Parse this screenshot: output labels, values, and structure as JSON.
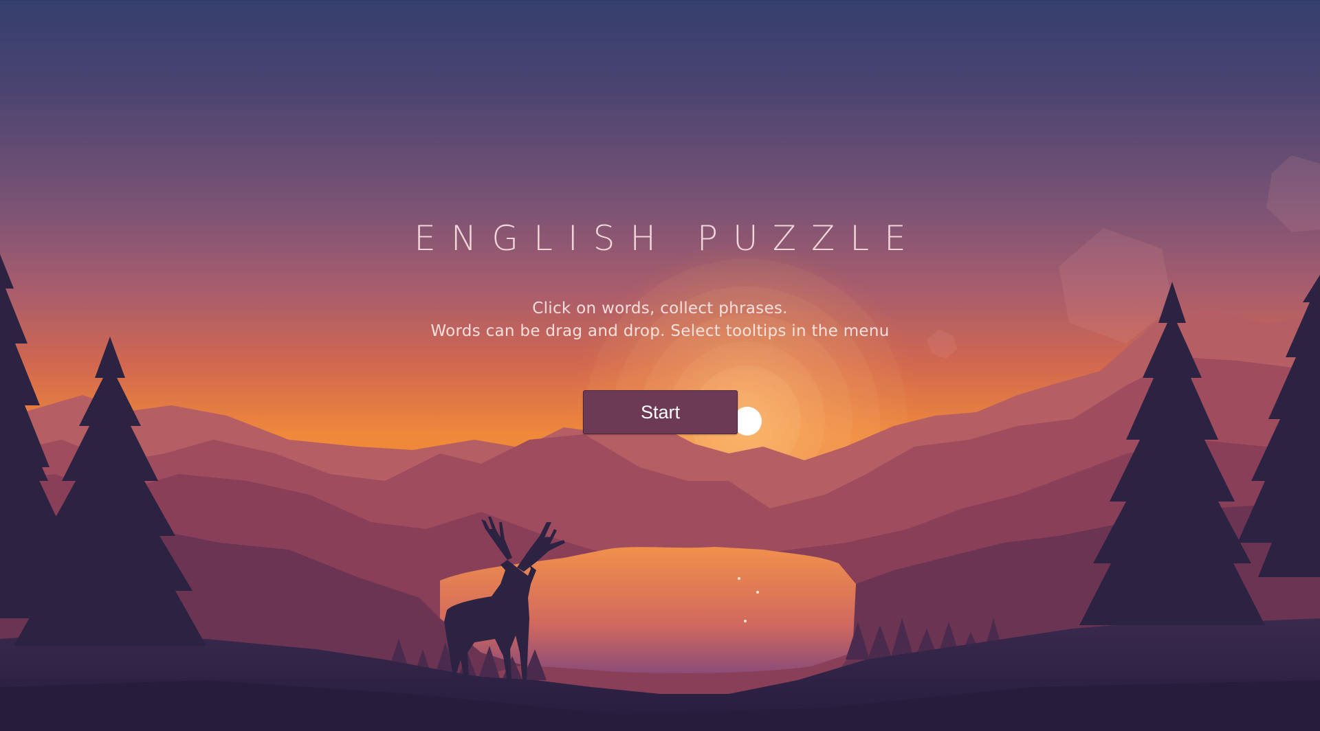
{
  "app": {
    "title": "ENGLISH PUZZLE",
    "subtitle_line1": "Click on words, collect phrases.",
    "subtitle_line2": "Words can be drag and drop. Select tooltips in the menu",
    "start_label": "Start"
  },
  "background": {
    "icon": "sunset-landscape-illustration",
    "colors": {
      "sky_top": "#353f6e",
      "sky_mid": "#9b5a70",
      "sky_horizon": "#f08a3a",
      "sun": "#ffffff",
      "mountains_far": "#a8586a",
      "mountains_mid": "#7d3b55",
      "forest_dark": "#2b2143",
      "lake": "#e07a55",
      "button": "#6c3a55"
    }
  }
}
